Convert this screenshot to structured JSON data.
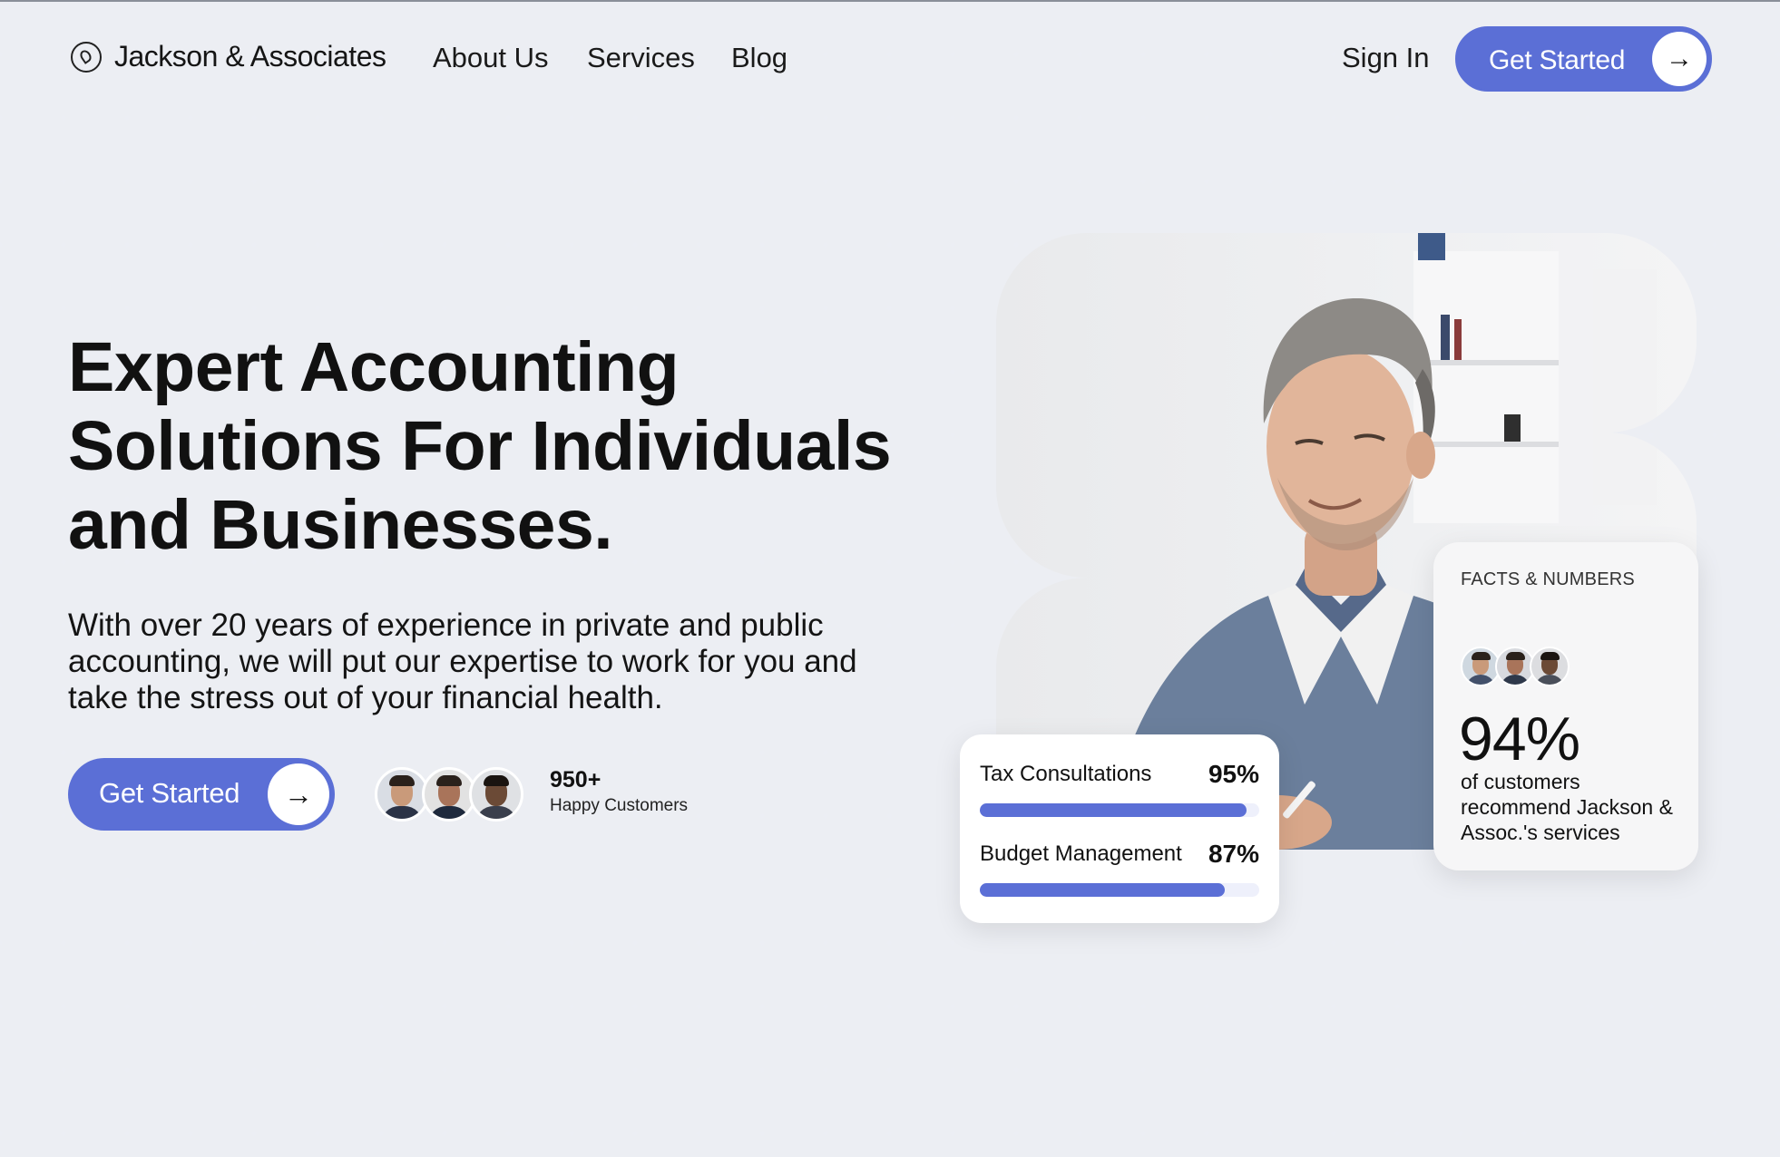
{
  "nav": {
    "brand": "Jackson & Associates",
    "links": [
      "About Us",
      "Services",
      "Blog"
    ],
    "sign_in": "Sign In",
    "cta": "Get Started"
  },
  "hero": {
    "headline": "Expert Accounting Solutions For Individuals and Businesses.",
    "subtext": "With over 20 years of experience in private and public accounting, we will put our expertise to work for you and take the stress out of your financial health.",
    "cta": "Get Started",
    "customers_count": "950+",
    "customers_label": "Happy Customers"
  },
  "stats_card": {
    "items": [
      {
        "label": "Tax Consultations",
        "percent_text": "95%",
        "value": 95
      },
      {
        "label": "Budget Management",
        "percent_text": "87%",
        "value": 87
      }
    ]
  },
  "facts_card": {
    "title": "FACTS & NUMBERS",
    "big_number": "94%",
    "description": "of customers recommend Jackson & Assoc.'s services"
  },
  "colors": {
    "accent": "#5b6fd6",
    "text": "#111111",
    "card_bg": "#f6f6f7"
  },
  "icons": {
    "brand": "leaf-circle-icon",
    "cta_arrow": "arrow-right-icon"
  }
}
